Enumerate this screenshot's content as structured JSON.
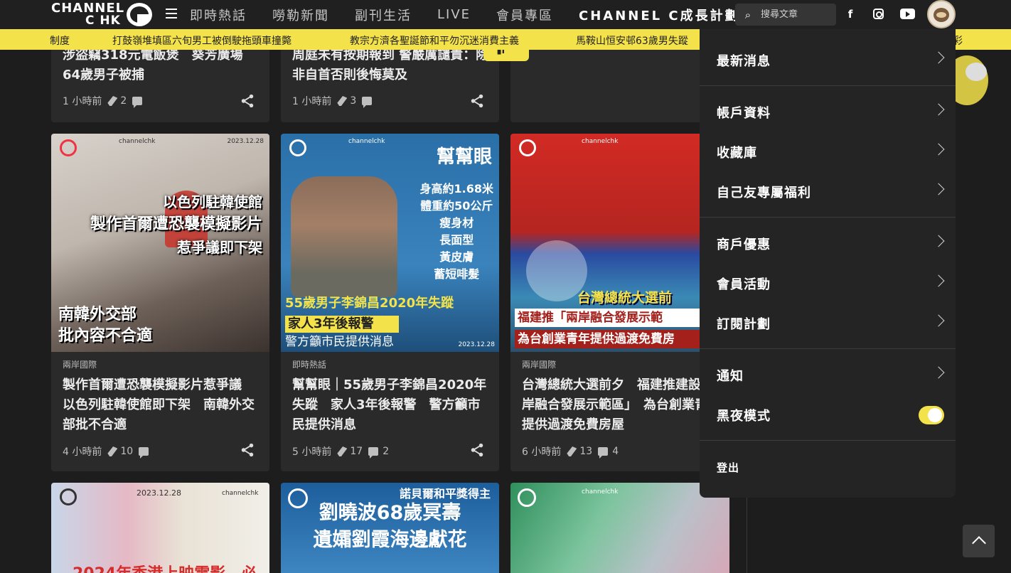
{
  "header": {
    "logo_line1": "CHANNEL",
    "logo_line2": "C HK",
    "nav": [
      {
        "label": "即時熱話"
      },
      {
        "label": "嘮勒新聞"
      },
      {
        "label": "副刊生活"
      },
      {
        "label": "LIVE"
      },
      {
        "label": "會員專區"
      },
      {
        "label": "CHANNEL C成長計劃"
      }
    ],
    "search_placeholder": "搜尋文章",
    "icons": [
      "menu-icon",
      "search-icon",
      "facebook-icon",
      "instagram-icon",
      "youtube-icon",
      "avatar"
    ]
  },
  "ticker": {
    "items": [
      {
        "text": "制度"
      },
      {
        "text": "打鼓嶺堆填區六旬男工被倒駛拖頭車撞斃"
      },
      {
        "text": "教宗方濟各聖誕節和平勿沉迷消費主義"
      },
      {
        "text": "馬鞍山恒安邨63歲男失蹤"
      },
      {
        "text": "彩"
      }
    ],
    "background": "#f3e24a"
  },
  "top_cards": [
    {
      "title": "涉盜竊318元電飯煲　葵芳廣場64歲男子被捕",
      "time": "1 小時前",
      "claps": "2",
      "comments": ""
    },
    {
      "title": "周庭未有按期報到 警嚴厲譴責：除非自首否則後悔莫及",
      "time": "1 小時前",
      "claps": "3",
      "comments": ""
    }
  ],
  "cards": [
    {
      "category": "兩岸國際",
      "title": "製作首爾遭恐襲模擬影片惹爭議　以色列駐韓使館即下架　南韓外交部批不合適",
      "time": "4 小時前",
      "claps": "10",
      "comments": "",
      "image": {
        "brand": "channelchk",
        "date": "2023.12.28",
        "headline_lines": [
          "以色列駐韓使館",
          "製作首爾遭恐襲模擬影片",
          "惹爭議即下架"
        ],
        "sub_lines": [
          "南韓外交部",
          "批內容不合適"
        ]
      }
    },
    {
      "category": "即時熱話",
      "title": "幫幫眼｜55歲男子李錦昌2020年失蹤　家人3年後報警　警方籲市民提供消息",
      "time": "5 小時前",
      "claps": "17",
      "comments": "2",
      "image": {
        "brand": "channelchk",
        "tag": "幫幫眼",
        "attributes": [
          "身高約1.68米",
          "體重約50公斤",
          "瘦身材",
          "長面型",
          "黃皮膚",
          "蓄短啡髮"
        ],
        "headline_lines": [
          "55歲男子李錦昌2020年失蹤",
          "家人3年後報警",
          "警方籲市民提供消息"
        ],
        "date": "2023.12.28"
      }
    },
    {
      "category": "兩岸國際",
      "title": "台灣總統大選前夕　福建推建設「兩岸融合發展示範區」　為台創業青年提供過渡免費房屋",
      "time": "6 小時前",
      "claps": "13",
      "comments": "4",
      "image": {
        "brand": "channelchk",
        "headline_lines": [
          "台灣總統大選前",
          "福建推「兩岸融合發展示範",
          "為台創業青年提供過渡免費房"
        ]
      }
    }
  ],
  "bottom_cards": [
    {
      "image": {
        "date": "2023.12.28",
        "brand": "channelchk",
        "headline": "2024年香港上映電影　必"
      }
    },
    {
      "image": {
        "top_text": "諾貝爾和平獎得主",
        "headline_lines": [
          "劉曉波68歲冥壽",
          "遺孀劉霞海邊獻花"
        ]
      }
    },
    {
      "image": {
        "brand": "channelchk"
      }
    }
  ],
  "overlay_tag": {
    "label": "▮i ^"
  },
  "dropdown": {
    "items": [
      {
        "label": "最新消息",
        "chevron": true
      },
      {
        "label": "帳戶資料",
        "chevron": true
      },
      {
        "label": "收藏庫",
        "chevron": true
      },
      {
        "label": "自己友專屬福利",
        "chevron": true
      },
      {
        "label": "商戶優惠",
        "chevron": true
      },
      {
        "label": "會員活動",
        "chevron": true
      },
      {
        "label": "訂閱計劃",
        "chevron": true
      },
      {
        "label": "通知",
        "chevron": true
      },
      {
        "label": "黑夜模式",
        "toggle": true,
        "toggle_on": true
      },
      {
        "label": "登出"
      }
    ]
  },
  "colors": {
    "accent": "#f3e24a",
    "background": "#1d1d1d",
    "card": "#2a2a2a",
    "panel": "#242424"
  }
}
